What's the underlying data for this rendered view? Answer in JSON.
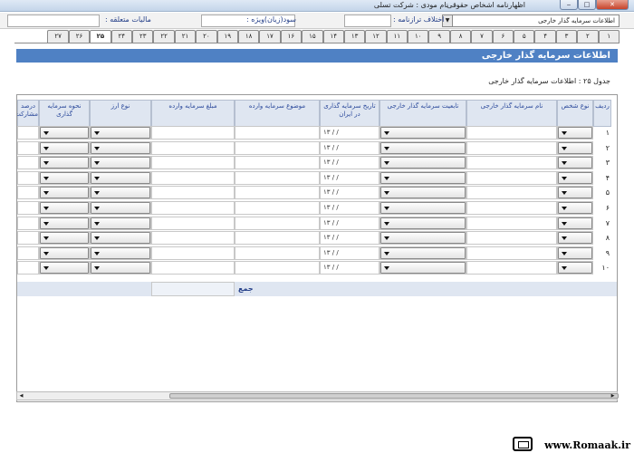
{
  "window": {
    "title_part1": "اظهارنامه اشخاص حقوقی",
    "title_part2": "نام مودی : شرکت تسلی",
    "min_label": "‒",
    "max_label": "□",
    "close_label": "✕"
  },
  "header": {
    "select_value": "اطلاعات سرمایه گذار خارجی",
    "select_arrow": "▼",
    "diff_label": "اختلاف ترازنامه :",
    "profit_label": "سود(زیان)ویژه :",
    "tax_label": "مالیات متعلقه :"
  },
  "tabs": [
    "۱",
    "۲",
    "۳",
    "۴",
    "۵",
    "۶",
    "۷",
    "۸",
    "۹",
    "۱۰",
    "۱۱",
    "۱۲",
    "۱۳",
    "۱۴",
    "۱۵",
    "۱۶",
    "۱۷",
    "۱۸",
    "۱۹",
    "۲۰",
    "۲۱",
    "۲۲",
    "۲۳",
    "۲۴",
    "۲۵",
    "۲۶",
    "۲۷"
  ],
  "active_tab": "۲۵",
  "section_title": "اطلاعات سرمایه گذار خارجی",
  "caption": "جدول ۲۵ : اطلاعات سرمایه گذار خارجی",
  "table": {
    "columns": {
      "row": "ردیف",
      "person_type": "نوع شخص",
      "investor_name": "نام سرمایه گذار خارجی",
      "nationality": "تابعیت سرمایه گذار خارجی",
      "invest_date": "تاریخ سرمایه گذاری در ایران",
      "subject": "موضوع سرمایه وارده",
      "amount": "مبلغ سرمایه وارده",
      "currency": "نوع ارز",
      "method": "نحوه سرمایه گذاری",
      "share": "درصد مشارکت"
    },
    "row_numbers": [
      "۱",
      "۲",
      "۳",
      "۴",
      "۵",
      "۶",
      "۷",
      "۸",
      "۹",
      "۱۰"
    ],
    "date_placeholder": "۱۳ /  /",
    "sum_label": "جمع"
  },
  "scroll": {
    "left_arrow": "◀",
    "right_arrow": "▶"
  },
  "watermark": "www.Romaak.ir"
}
